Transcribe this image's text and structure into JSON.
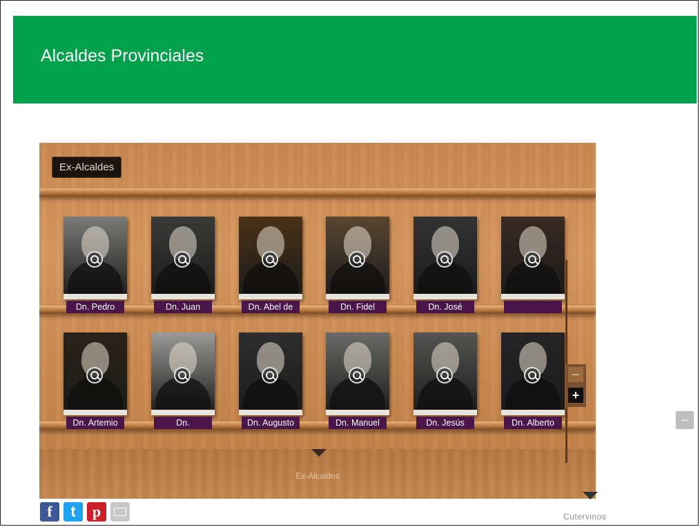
{
  "header": {
    "title": "Alcaldes Provinciales"
  },
  "shelf": {
    "tab_label": "Ex-Alcaldes",
    "floor_label": "Ex-Alcaldes",
    "rows": [
      [
        {
          "name": "Dn. Pedro",
          "tone": "#7a7a78"
        },
        {
          "name": "Dn. Juan",
          "tone": "#3a3a38"
        },
        {
          "name": "Dn. Abel de",
          "tone": "#4a3218"
        },
        {
          "name": "Dn. Fidel",
          "tone": "#5a4632"
        },
        {
          "name": "Dn. José",
          "tone": "#333333"
        },
        {
          "name": "",
          "tone": "#3a2a22"
        }
      ],
      [
        {
          "name": "Dn. Artemio",
          "tone": "#2a2418"
        },
        {
          "name": "Dn.",
          "tone": "#9a9a98"
        },
        {
          "name": "Dn. Augusto",
          "tone": "#2e2e2e"
        },
        {
          "name": "Dn. Manuel",
          "tone": "#6a6a68"
        },
        {
          "name": "Dn. Jesús",
          "tone": "#555553"
        },
        {
          "name": "Dn. Alberto",
          "tone": "#252525"
        }
      ]
    ]
  },
  "controls": {
    "zoom_out": "–",
    "zoom_in": "+",
    "side_button": "–"
  },
  "social": {
    "facebook": "f",
    "twitter": "t",
    "pinterest": "p"
  },
  "footer": {
    "text": "Cutervinos"
  }
}
